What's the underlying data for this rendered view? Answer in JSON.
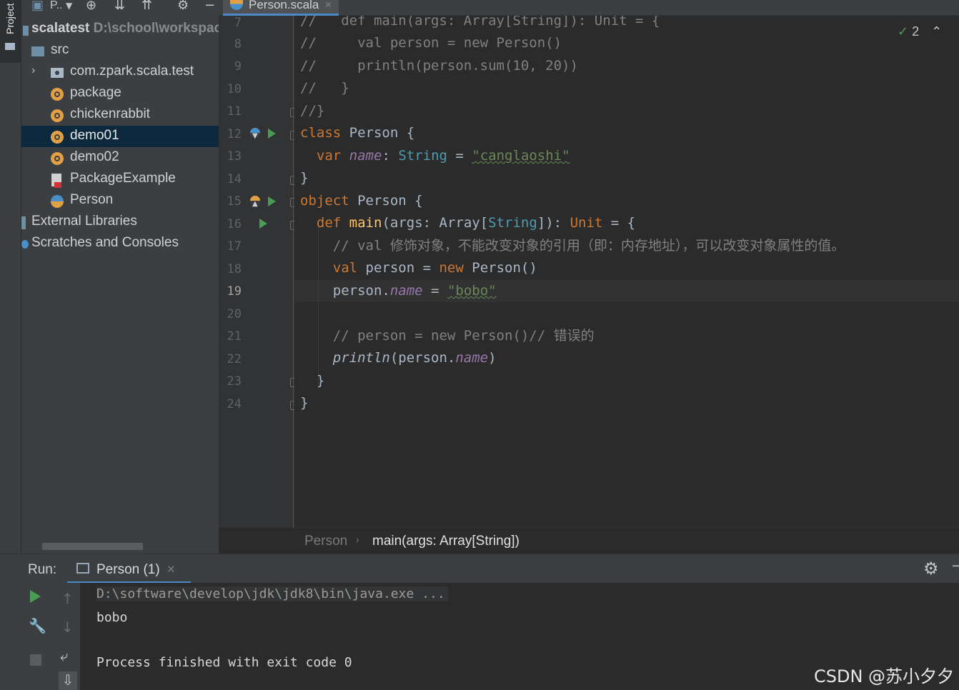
{
  "tool_window": {
    "vertical_tab": "Project"
  },
  "project_panel": {
    "toolbar_title": "P..",
    "tree": [
      {
        "label": "scalatest",
        "extra": "D:\\school\\workspace",
        "icon": "module-icon"
      },
      {
        "label": "src",
        "icon": "folder-icon"
      },
      {
        "label": "com.zpark.scala.test",
        "icon": "package-icon"
      },
      {
        "label": "package",
        "icon": "package-object-icon"
      },
      {
        "label": "chickenrabbit",
        "icon": "scala-object-icon"
      },
      {
        "label": "demo01",
        "icon": "scala-object-icon",
        "selected": true
      },
      {
        "label": "demo02",
        "icon": "scala-object-icon"
      },
      {
        "label": "PackageExample",
        "icon": "scala-file-icon"
      },
      {
        "label": "Person",
        "icon": "scala-class-object-icon"
      },
      {
        "label": "External Libraries",
        "icon": "library-icon"
      },
      {
        "label": "Scratches and Consoles",
        "icon": "scratch-icon"
      }
    ]
  },
  "editor": {
    "tab": {
      "label": "Person.scala",
      "close": "×"
    },
    "inspection": {
      "count": "2"
    },
    "line_numbers": [
      "7",
      "8",
      "9",
      "10",
      "11",
      "12",
      "13",
      "14",
      "15",
      "16",
      "17",
      "18",
      "19",
      "20",
      "21",
      "22",
      "23",
      "24"
    ],
    "current_line": "19",
    "code": {
      "l7": {
        "c": "//   def main(args: Array[String]): Unit = {"
      },
      "l8": {
        "c": "//     val person = new Person()"
      },
      "l9": {
        "c": "//     println(person.sum(10, 20))"
      },
      "l10": {
        "c": "//   }"
      },
      "l11": {
        "c": "//}"
      },
      "l12": {
        "kw": "class",
        "name": " Person {"
      },
      "l13": {
        "indent": "  ",
        "kw": "var",
        "sp": " ",
        "field": "name",
        "colon": ": ",
        "type": "String",
        "eq": " = ",
        "str": "\"canglaoshi\""
      },
      "l14": {
        "c": "}"
      },
      "l15": {
        "kw": "object",
        "name": " Person {"
      },
      "l16": {
        "indent": "  ",
        "kw": "def",
        "sp": " ",
        "fn": "main",
        "p1": "(args: Array[",
        "type": "String",
        "p2": "]): ",
        "unit": "Unit",
        "p3": " = {"
      },
      "l17": {
        "c": "    // val 修饰对象，不能改变对象的引用（即：内存地址），可以改变对象属性的值。"
      },
      "l18": {
        "indent": "    ",
        "kw1": "val",
        "mid": " person = ",
        "kw2": "new",
        "rest": " Person()"
      },
      "l19": {
        "indent": "    ",
        "obj": "person.",
        "field": "name",
        "eq": " = ",
        "str": "\"bobo\""
      },
      "l21": {
        "c": "    // person = new Person()// 错误的"
      },
      "l22": {
        "indent": "    ",
        "fn": "println",
        "open": "(person.",
        "field": "name",
        "close": ")"
      },
      "l23": {
        "c": "  }"
      },
      "l24": {
        "c": "}"
      }
    },
    "breadcrumb": [
      "Person",
      "main(args: Array[String])"
    ]
  },
  "run_panel": {
    "label": "Run:",
    "tab_label": "Person (1)",
    "tab_close": "×",
    "console": [
      "D:\\software\\develop\\jdk\\jdk8\\bin\\java.exe ...",
      "bobo",
      "",
      "Process finished with exit code 0"
    ]
  },
  "watermark": "CSDN @苏小夕夕",
  "colors": {
    "keyword": "#cc7832",
    "comment": "#808080",
    "string": "#6a8759",
    "field": "#9876aa",
    "function": "#ffc66d",
    "accent": "#4a88c7",
    "run_green": "#499c54"
  }
}
